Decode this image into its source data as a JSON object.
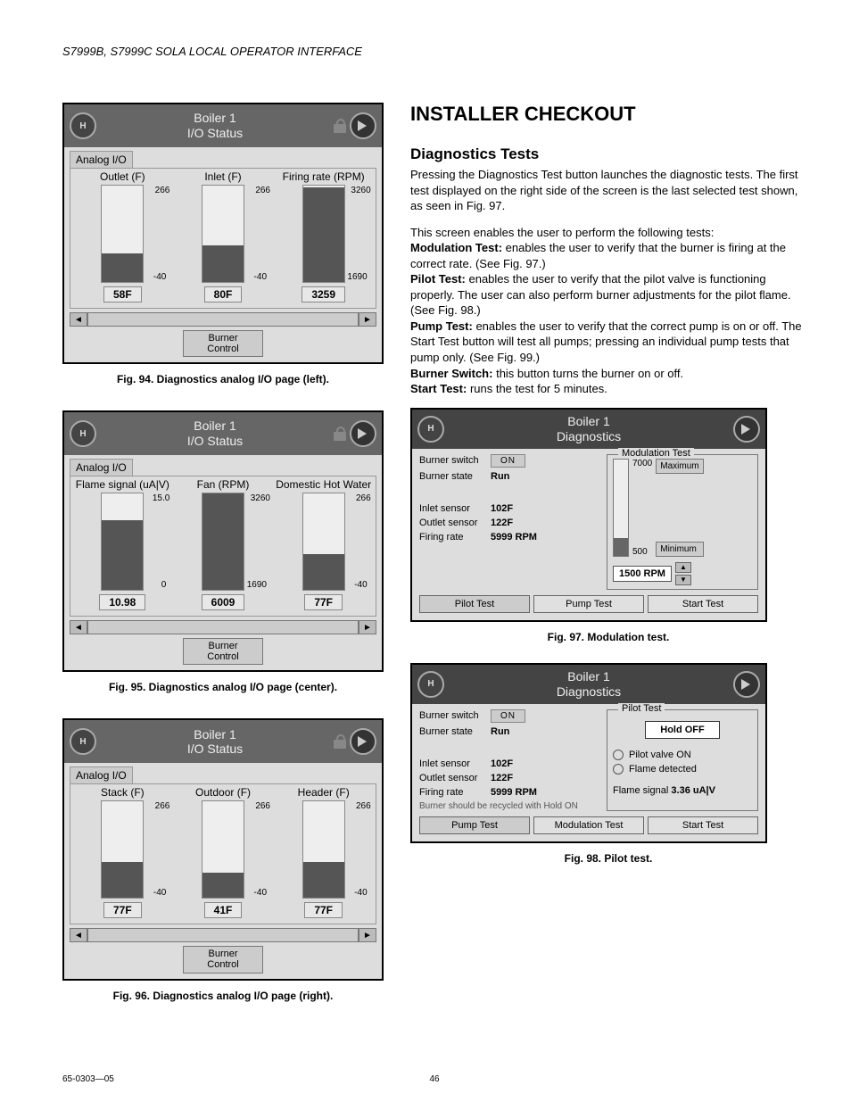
{
  "header": "S7999B, S7999C SOLA LOCAL OPERATOR INTERFACE",
  "footer": {
    "left": "65-0303—05",
    "center": "46"
  },
  "main": {
    "h1": "INSTALLER CHECKOUT",
    "h2": "Diagnostics Tests",
    "p1": "Pressing the Diagnostics Test button launches the diagnostic tests. The first test displayed on the right side of the screen is the last selected test shown, as seen in Fig. 97.",
    "p2_intro": "This screen enables the user to perform the following tests:",
    "mod_label": "Modulation Test:",
    "mod_text": " enables the user to verify that the burner is firing at the correct rate. (See Fig. 97.)",
    "pilot_label": "Pilot Test:",
    "pilot_text": " enables the user to verify that the pilot valve is functioning properly. The user can also perform burner adjustments for the pilot flame. (See Fig. 98.)",
    "pump_label": "Pump Test:",
    "pump_text": " enables the user to verify that the correct pump is on or off. The Start Test button will test all pumps; pressing an individual pump tests that pump only. (See Fig. 99.)",
    "burner_label": "Burner Switch:",
    "burner_text": " this button turns the burner on or off.",
    "start_label": "Start Test:",
    "start_text": " runs the test for 5 minutes."
  },
  "fig94": {
    "caption": "Fig. 94. Diagnostics analog I/O page (left).",
    "title_l1": "Boiler 1",
    "title_l2": "I/O Status",
    "tab": "Analog I/O",
    "burner_btn_l1": "Burner",
    "burner_btn_l2": "Control",
    "gauges": [
      {
        "label": "Outlet (F)",
        "top": "266",
        "bot": "-40",
        "value": "58F",
        "fill": 30
      },
      {
        "label": "Inlet (F)",
        "top": "266",
        "bot": "-40",
        "value": "80F",
        "fill": 38
      },
      {
        "label": "Firing rate (RPM)",
        "top": "3260",
        "bot": "1690",
        "value": "3259",
        "fill": 98
      }
    ]
  },
  "fig95": {
    "caption": "Fig. 95. Diagnostics analog I/O page (center).",
    "title_l1": "Boiler 1",
    "title_l2": "I/O Status",
    "tab": "Analog I/O",
    "burner_btn_l1": "Burner",
    "burner_btn_l2": "Control",
    "gauges": [
      {
        "label": "Flame signal (uA|V)",
        "top": "15.0",
        "bot": "0",
        "value": "10.98",
        "fill": 72
      },
      {
        "label": "Fan (RPM)",
        "top": "3260",
        "bot": "1690",
        "value": "6009",
        "fill": 100
      },
      {
        "label": "Domestic Hot Water",
        "top": "266",
        "bot": "-40",
        "value": "77F",
        "fill": 37
      }
    ]
  },
  "fig96": {
    "caption": "Fig. 96. Diagnostics analog I/O page (right).",
    "title_l1": "Boiler 1",
    "title_l2": "I/O Status",
    "tab": "Analog I/O",
    "burner_btn_l1": "Burner",
    "burner_btn_l2": "Control",
    "gauges": [
      {
        "label": "Stack (F)",
        "top": "266",
        "bot": "-40",
        "value": "77F",
        "fill": 37
      },
      {
        "label": "Outdoor (F)",
        "top": "266",
        "bot": "-40",
        "value": "41F",
        "fill": 26
      },
      {
        "label": "Header (F)",
        "top": "266",
        "bot": "-40",
        "value": "77F",
        "fill": 37
      }
    ]
  },
  "fig97": {
    "caption": "Fig. 97. Modulation test.",
    "title_l1": "Boiler 1",
    "title_l2": "Diagnostics",
    "panel_title": "Modulation Test",
    "rows": {
      "burner_switch": {
        "label": "Burner switch",
        "value": "ON"
      },
      "burner_state": {
        "label": "Burner state",
        "value": "Run"
      },
      "inlet": {
        "label": "Inlet sensor",
        "value": "102F"
      },
      "outlet": {
        "label": "Outlet sensor",
        "value": "122F"
      },
      "firing": {
        "label": "Firing rate",
        "value": "5999 RPM"
      }
    },
    "gauge": {
      "top": "7000",
      "bot": "500",
      "max": "Maximum",
      "min": "Minimum",
      "rpm": "1500 RPM",
      "fill": 18
    },
    "buttons": [
      "Pilot Test",
      "Pump Test",
      "Start Test"
    ]
  },
  "fig98": {
    "caption": "Fig. 98. Pilot test.",
    "title_l1": "Boiler 1",
    "title_l2": "Diagnostics",
    "panel_title": "Pilot Test",
    "rows": {
      "burner_switch": {
        "label": "Burner switch",
        "value": "ON"
      },
      "burner_state": {
        "label": "Burner state",
        "value": "Run"
      },
      "inlet": {
        "label": "Inlet sensor",
        "value": "102F"
      },
      "outlet": {
        "label": "Outlet sensor",
        "value": "122F"
      },
      "firing": {
        "label": "Firing rate",
        "value": "5999 RPM"
      }
    },
    "hold": "Hold OFF",
    "radios": [
      "Pilot valve ON",
      "Flame detected"
    ],
    "flame_label": "Flame signal",
    "flame_value": "3.36 uA|V",
    "note": "Burner should be recycled with Hold ON",
    "buttons": [
      "Pump Test",
      "Modulation Test",
      "Start Test"
    ]
  }
}
